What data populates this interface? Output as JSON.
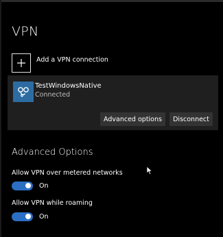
{
  "page": {
    "title": "VPN"
  },
  "add_connection": {
    "label": "Add a VPN connection",
    "icon": "plus-icon"
  },
  "connection": {
    "name": "TestWindowsNative",
    "status": "Connected",
    "icon": "vpn-connection-icon",
    "icon_color": "#2d6ca2"
  },
  "buttons": {
    "advanced": "Advanced options",
    "disconnect": "Disconnect"
  },
  "advanced_options": {
    "title": "Advanced Options",
    "metered": {
      "label": "Allow VPN over metered networks",
      "state": "On",
      "value": true
    },
    "roaming": {
      "label": "Allow VPN while roaming",
      "state": "On",
      "value": true
    }
  },
  "colors": {
    "accent": "#2b6fc4",
    "background": "#000000",
    "panel": "#1f1f1f",
    "button": "#333333"
  }
}
